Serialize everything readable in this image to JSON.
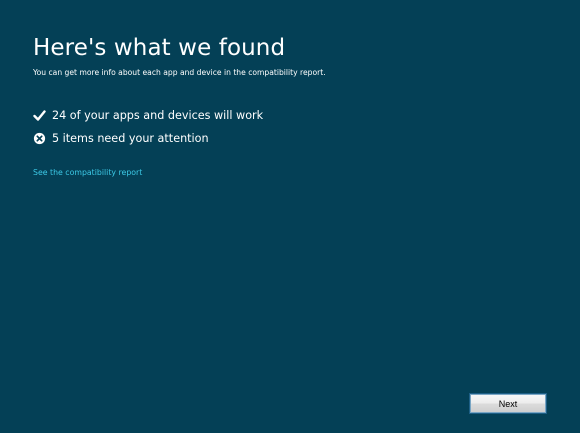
{
  "header": {
    "title": "Here's what we found",
    "subtitle": "You can get more info about each app and device in the compatibility report."
  },
  "results": [
    {
      "icon": "checkmark-icon",
      "text": "24 of your apps and devices will work"
    },
    {
      "icon": "error-circle-icon",
      "text": "5 items need your attention"
    }
  ],
  "links": {
    "compatibility_report": "See the compatibility report"
  },
  "footer": {
    "next_label": "Next"
  },
  "colors": {
    "background": "#044056",
    "link": "#3cc9e6",
    "text": "#ffffff"
  }
}
